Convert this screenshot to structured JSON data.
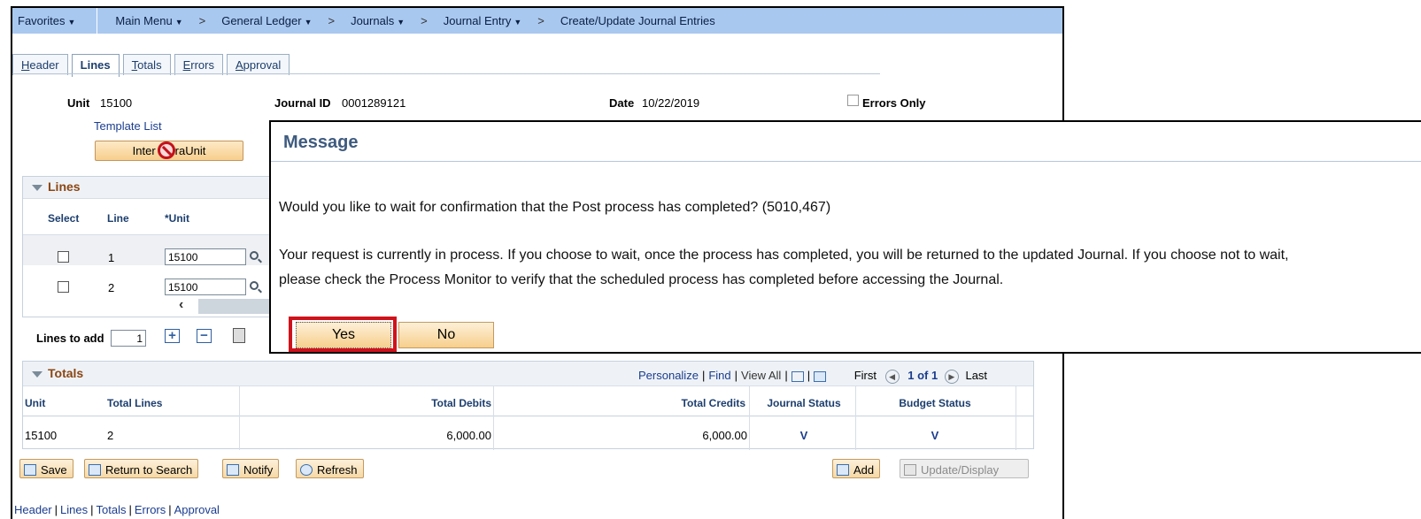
{
  "nav": {
    "favorites": "Favorites",
    "main_menu": "Main Menu",
    "general_ledger": "General Ledger",
    "journals": "Journals",
    "journal_entry": "Journal Entry",
    "current": "Create/Update Journal Entries"
  },
  "tabs": [
    {
      "label": "Header",
      "ul": "H",
      "rest": "eader"
    },
    {
      "label": "Lines",
      "ul": "",
      "rest": "Lines"
    },
    {
      "label": "Totals",
      "ul": "T",
      "rest": "otals"
    },
    {
      "label": "Errors",
      "ul": "E",
      "rest": "rrors"
    },
    {
      "label": "Approval",
      "ul": "A",
      "rest": "pproval"
    }
  ],
  "header": {
    "unit_label": "Unit",
    "unit_value": "15100",
    "journal_id_label": "Journal ID",
    "journal_id_value": "0001289121",
    "date_label": "Date",
    "date_value": "10/22/2019",
    "errors_only_label": "Errors Only",
    "template_list": "Template List",
    "inter_intra_button_a": "Inter",
    "inter_intra_button_b": "raUnit"
  },
  "lines": {
    "title": "Lines",
    "columns": {
      "select": "Select",
      "line": "Line",
      "unit": "*Unit"
    },
    "rows": [
      {
        "line": "1",
        "unit": "15100"
      },
      {
        "line": "2",
        "unit": "15100"
      }
    ],
    "lines_to_add_label": "Lines to add",
    "lines_to_add_value": "1"
  },
  "totals": {
    "title": "Totals",
    "toolbar": {
      "personalize": "Personalize",
      "find": "Find",
      "view_all": "View All",
      "first": "First",
      "count": "1 of 1",
      "last": "Last"
    },
    "columns": [
      "Unit",
      "Total Lines",
      "Total Debits",
      "Total Credits",
      "Journal Status",
      "Budget Status"
    ],
    "row": {
      "unit": "15100",
      "total_lines": "2",
      "total_debits": "6,000.00",
      "total_credits": "6,000.00",
      "journal_status": "V",
      "budget_status": "V"
    }
  },
  "toolbar": {
    "save": "Save",
    "return_to_search": "Return to Search",
    "notify": "Notify",
    "refresh": "Refresh",
    "add": "Add",
    "update_display": "Update/Display"
  },
  "footer_links": [
    "Header",
    "Lines",
    "Totals",
    "Errors",
    "Approval"
  ],
  "dialog": {
    "title": "Message",
    "question": "Would you like to wait for confirmation that the Post process has completed? (5010,467)",
    "body_line1": "Your request is currently in process.  If you choose to wait, once the process has completed, you will be returned to the updated Journal.  If you choose not to wait,",
    "body_line2": "please check the Process Monitor to verify that the scheduled process has completed before accessing the Journal.",
    "yes": "Yes",
    "no": "No"
  },
  "colors": {
    "nav_bg": "#a9c8ef",
    "highlight": "#d0121b",
    "group_title": "#8b4513",
    "link": "#1b3d8f"
  }
}
